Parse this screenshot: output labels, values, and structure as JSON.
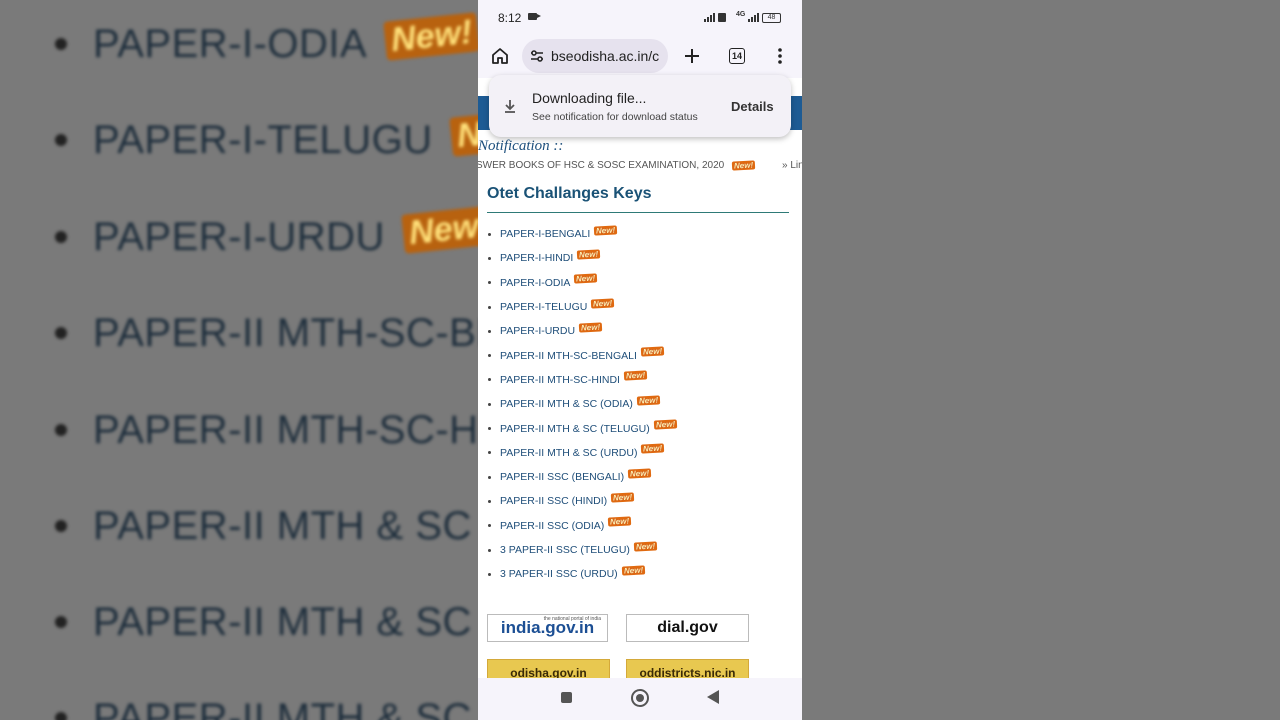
{
  "backdrop": {
    "rows": [
      {
        "text": "PAPER-I-ODIA",
        "badge": "New!"
      },
      {
        "text": "PAPER-I-TELUGU",
        "badge": "New!"
      },
      {
        "text": "PAPER-I-URDU",
        "badge": "New!"
      },
      {
        "text": "PAPER-II MTH-SC-BEN",
        "badge": ""
      },
      {
        "text": "PAPER-II MTH-SC-HIN",
        "badge": ""
      },
      {
        "text": "PAPER-II MTH & SC (",
        "badge": ""
      },
      {
        "text": "PAPER-II MTH & SC (",
        "badge": ""
      },
      {
        "text": "PAPER-II MTH & SC (",
        "badge": ""
      }
    ]
  },
  "status_bar": {
    "time": "8:12",
    "network": "4G",
    "battery": "48"
  },
  "browser": {
    "url": "bseodisha.ac.in/c",
    "tab_count": "14"
  },
  "download": {
    "title": "Downloading file...",
    "subtitle": "See notification for download status",
    "details_label": "Details"
  },
  "page": {
    "notification_label": "Notification ::",
    "marquee_text": "SWER BOOKS OF HSC & SOSC EXAMINATION, 2020",
    "marquee_more": "» Lin",
    "section_title": "Otet Challanges Keys",
    "new_badge": "New!",
    "items": [
      "PAPER-I-BENGALI",
      "PAPER-I-HINDI",
      "PAPER-I-ODIA",
      "PAPER-I-TELUGU",
      "PAPER-I-URDU",
      "PAPER-II MTH-SC-BENGALI",
      "PAPER-II MTH-SC-HINDI",
      "PAPER-II MTH & SC (ODIA)",
      "PAPER-II MTH & SC (TELUGU)",
      "PAPER-II MTH & SC (URDU)",
      "PAPER-II SSC (BENGALI)",
      "PAPER-II SSC (HINDI)",
      "PAPER-II SSC (ODIA)",
      "3 PAPER-II SSC (TELUGU)",
      "3 PAPER-II SSC (URDU)"
    ],
    "logos": {
      "india": "india.gov.in",
      "india_sub": "the national portal of india",
      "dial": "dial.gov",
      "odisha": "odisha.gov.in",
      "oddistricts": "oddistricts.nic.in"
    }
  }
}
